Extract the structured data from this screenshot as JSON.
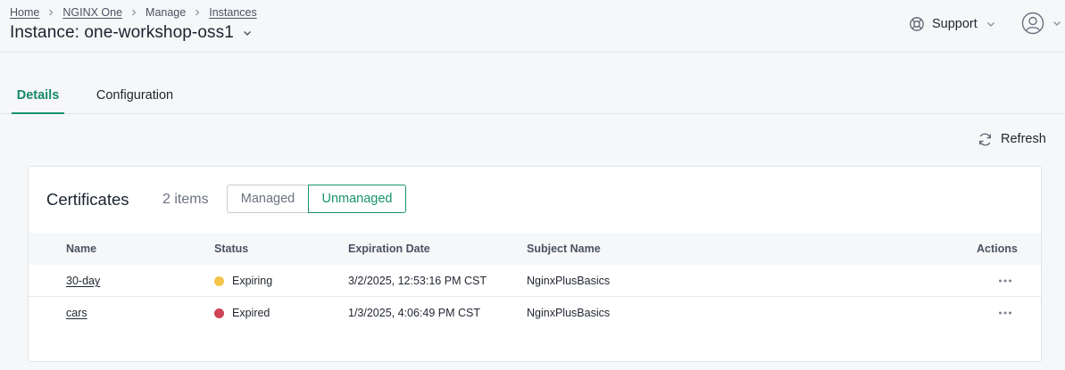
{
  "breadcrumb": {
    "home": "Home",
    "nginx_one": "NGINX One",
    "manage": "Manage",
    "instances": "Instances"
  },
  "page": {
    "title": "Instance: one-workshop-oss1"
  },
  "header": {
    "support_label": "Support",
    "support_icon": "lifebuoy-icon",
    "user_icon": "user-avatar-icon"
  },
  "tabs": [
    {
      "label": "Details",
      "active": true
    },
    {
      "label": "Configuration",
      "active": false
    }
  ],
  "toolbar": {
    "refresh_label": "Refresh"
  },
  "certificates": {
    "title": "Certificates",
    "count": "2 items",
    "filters": [
      {
        "label": "Managed",
        "selected": false
      },
      {
        "label": "Unmanaged",
        "selected": true
      }
    ],
    "columns": [
      "Name",
      "Status",
      "Expiration Date",
      "Subject Name",
      "Actions"
    ],
    "rows": [
      {
        "name": "30-day",
        "status": "Expiring",
        "status_color": "#f5c54c",
        "expiration": "3/2/2025, 12:53:16 PM CST",
        "subject": "NginxPlusBasics"
      },
      {
        "name": "cars",
        "status": "Expired",
        "status_color": "#cf4456",
        "expiration": "1/3/2025, 4:06:49 PM CST",
        "subject": "NginxPlusBasics"
      }
    ]
  },
  "colors": {
    "accent": "#17946f",
    "background": "#f6f7f8",
    "card": "#ffffff"
  }
}
